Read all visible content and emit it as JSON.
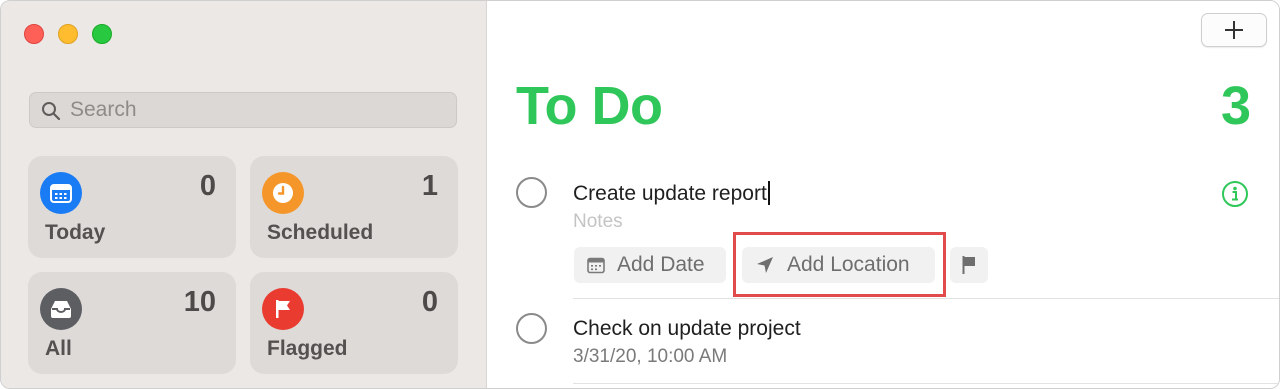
{
  "sidebar": {
    "search": {
      "placeholder": "Search"
    },
    "smart_lists": [
      {
        "label": "Today",
        "count": "0",
        "icon": "calendar-icon",
        "color": "#1a7cf5"
      },
      {
        "label": "Scheduled",
        "count": "1",
        "icon": "clock-icon",
        "color": "#f5962a"
      },
      {
        "label": "All",
        "count": "10",
        "icon": "tray-icon",
        "color": "#5d5e62"
      },
      {
        "label": "Flagged",
        "count": "0",
        "icon": "flag-icon",
        "color": "#ea3b30"
      }
    ]
  },
  "main": {
    "add_button_icon": "plus-icon",
    "list_title": "To Do",
    "list_count": "3",
    "accent_color": "#30c75a",
    "reminders": [
      {
        "title": "Create update report",
        "notes_placeholder": "Notes",
        "actions": {
          "add_date": "Add Date",
          "add_location": "Add Location",
          "flag_icon": "flag-icon"
        },
        "info_icon": "info-icon"
      },
      {
        "title": "Check on update project",
        "subtitle": "3/31/20, 10:00 AM"
      }
    ],
    "highlight_color": "#e24b4b"
  }
}
